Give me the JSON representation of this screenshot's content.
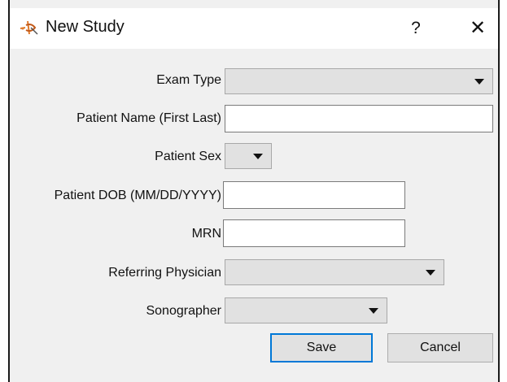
{
  "window": {
    "title": "New Study",
    "help_glyph": "?",
    "close_glyph": "✕",
    "icon": "app-logo-icon"
  },
  "form": {
    "exam_type": {
      "label": "Exam Type",
      "value": ""
    },
    "patient_name": {
      "label": "Patient Name (First Last)",
      "value": ""
    },
    "patient_sex": {
      "label": "Patient Sex",
      "value": ""
    },
    "patient_dob": {
      "label": "Patient DOB (MM/DD/YYYY)",
      "value": ""
    },
    "mrn": {
      "label": "MRN",
      "value": ""
    },
    "referring_physician": {
      "label": "Referring Physician",
      "value": ""
    },
    "sonographer": {
      "label": "Sonographer",
      "value": ""
    }
  },
  "buttons": {
    "save": "Save",
    "cancel": "Cancel"
  },
  "colors": {
    "accent": "#0078d7",
    "dialog_bg": "#f0f0f0",
    "combo_bg": "#e1e1e1"
  }
}
